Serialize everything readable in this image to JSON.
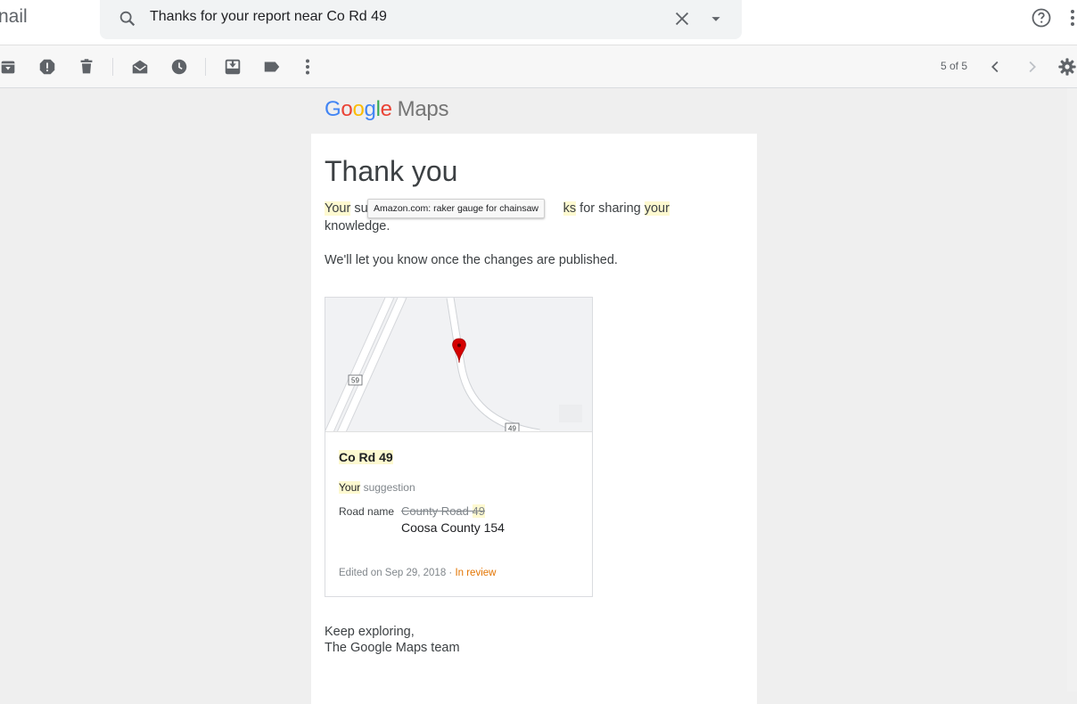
{
  "header": {
    "brand_fragment": "nail",
    "search_query": "Thanks for your report near Co Rd 49",
    "icons": [
      "search-icon",
      "clear-icon",
      "dropdown-arrow-icon",
      "help-icon",
      "more-vert-icon"
    ]
  },
  "toolbar": {
    "icons": [
      "archive-icon",
      "report-spam-icon",
      "delete-icon",
      "mark-unread-icon",
      "snooze-icon",
      "move-to-icon",
      "label-icon",
      "more-icon",
      "prev-icon",
      "next-icon",
      "settings-icon"
    ],
    "counter": "5 of 5"
  },
  "email": {
    "logo": {
      "letters": [
        {
          "ch": "G",
          "color": "#4285F4"
        },
        {
          "ch": "o",
          "color": "#EA4335"
        },
        {
          "ch": "o",
          "color": "#FBBC05"
        },
        {
          "ch": "g",
          "color": "#4285F4"
        },
        {
          "ch": "l",
          "color": "#34A853"
        },
        {
          "ch": "e",
          "color": "#EA4335"
        }
      ],
      "maps": "Maps"
    },
    "title": "Thank you",
    "para1": {
      "your1": "Your",
      "mid1": " su",
      "mid2": "ks",
      "mid3": " for sharing ",
      "your2": "your",
      "end": " knowledge."
    },
    "tooltip": "Amazon.com: raker gauge for chainsaw",
    "para2": "We'll let you know once the changes are published.",
    "suggestion": {
      "map": {
        "label_59": "59",
        "label_49": "49"
      },
      "road_name": "Co Rd 49",
      "your": "Your",
      "suggestion_word": " suggestion",
      "field_label": "Road name",
      "old_value_pre": "County Road ",
      "old_value_num": "49",
      "new_value": "Coosa County 154",
      "edited": "Edited on Sep 29, 2018 · ",
      "status": "In review"
    },
    "signoff": {
      "line1": "Keep exploring,",
      "line2": "The Google Maps team"
    }
  },
  "colors": {
    "highlight": "#fdf9d0",
    "status_orange": "#e37400",
    "pin_red": "#d50000"
  }
}
